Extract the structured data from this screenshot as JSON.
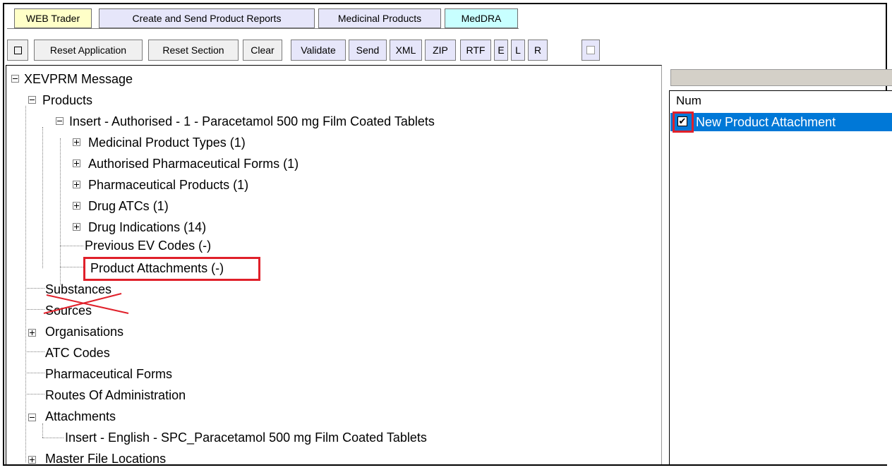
{
  "tabs": [
    {
      "label": "WEB Trader",
      "color": "#ffffc8"
    },
    {
      "label": "Create and Send Product Reports",
      "color": "#e6e6fa"
    },
    {
      "label": "Medicinal Products",
      "color": "#e6e6fa"
    },
    {
      "label": "MedDRA",
      "color": "#c8ffff"
    }
  ],
  "toolbar": {
    "reset_application": "Reset Application",
    "reset_section": "Reset Section",
    "clear": "Clear",
    "validate": "Validate",
    "send": "Send",
    "xml": "XML",
    "zip": "ZIP",
    "rtf": "RTF",
    "e": "E",
    "l": "L",
    "r": "R"
  },
  "tree": {
    "root": "XEVPRM Message",
    "products": "Products",
    "product_insert": "Insert - Authorised - 1 - Paracetamol 500 mg Film Coated Tablets",
    "medicinal_product_types": "Medicinal Product Types (1)",
    "authorised_pharmaceutical_forms": "Authorised Pharmaceutical Forms (1)",
    "pharmaceutical_products": "Pharmaceutical Products (1)",
    "drug_atcs": "Drug ATCs (1)",
    "drug_indications": "Drug Indications (14)",
    "previous_ev_codes": "Previous EV Codes (-)",
    "product_attachments": "Product Attachments (-)",
    "substances": "Substances",
    "sources": "Sources",
    "organisations": "Organisations",
    "atc_codes": "ATC Codes",
    "pharmaceutical_forms": "Pharmaceutical Forms",
    "routes_of_administration": "Routes Of Administration",
    "attachments": "Attachments",
    "attachment_insert": "Insert - English - SPC_Paracetamol 500 mg Film Coated Tablets",
    "master_file_locations": "Master File Locations"
  },
  "right_panel": {
    "column_header": "Num",
    "selected_item": "New Product Attachment",
    "selected_checked": true,
    "selection_color": "#0078d7"
  },
  "highlight_color": "#e0202a"
}
